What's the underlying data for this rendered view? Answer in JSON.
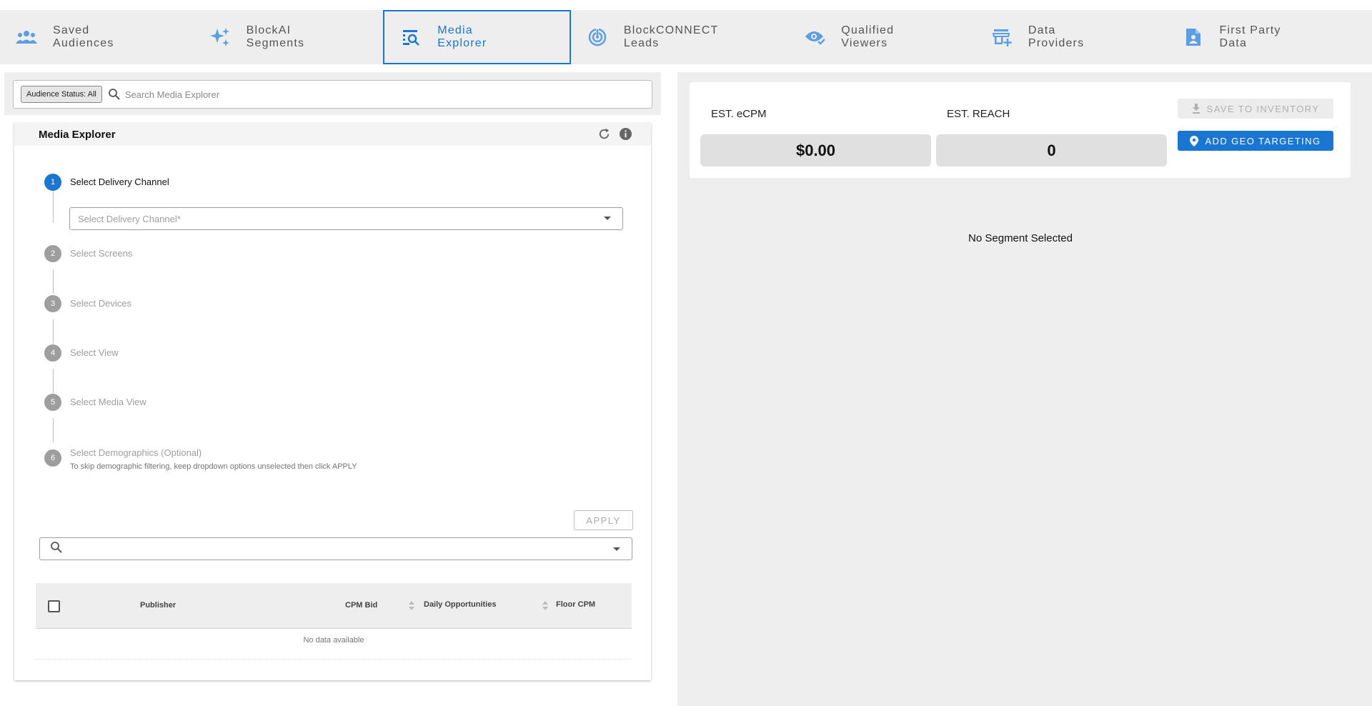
{
  "nav": {
    "tabs": [
      {
        "label": "Saved\nAudiences",
        "icon": "people-icon"
      },
      {
        "label": "BlockAI\nSegments",
        "icon": "sparkle-icon"
      },
      {
        "label": "Media\nExplorer",
        "icon": "media-search-icon",
        "active": true
      },
      {
        "label": "BlockCONNECT\nLeads",
        "icon": "radar-icon"
      },
      {
        "label": "Qualified\nViewers",
        "icon": "eye-check-icon"
      },
      {
        "label": "Data\nProviders",
        "icon": "store-add-icon"
      },
      {
        "label": "First Party\nData",
        "icon": "file-person-icon"
      }
    ],
    "accent_color": "#1976d2",
    "icon_color": "#5a9fe6"
  },
  "search": {
    "status_chip": "Audience Status: All",
    "placeholder": "Search Media Explorer"
  },
  "explorer": {
    "title": "Media Explorer",
    "steps": [
      {
        "num": "1",
        "label": "Select Delivery Channel",
        "active": true
      },
      {
        "num": "2",
        "label": "Select Screens"
      },
      {
        "num": "3",
        "label": "Select Devices"
      },
      {
        "num": "4",
        "label": "Select View"
      },
      {
        "num": "5",
        "label": "Select Media View"
      },
      {
        "num": "6",
        "label": "Select Demographics (Optional)",
        "sub": "To skip demographic filtering, keep dropdown options unselected then click APPLY"
      }
    ],
    "channel_placeholder": "Select Delivery Channel*",
    "apply_label": "APPLY"
  },
  "table": {
    "columns": [
      "Publisher",
      "CPM Bid",
      "Daily Opportunities",
      "Floor CPM"
    ],
    "empty_text": "No data available"
  },
  "estimates": {
    "ecpm_label": "EST. eCPM",
    "ecpm_value": "$0.00",
    "reach_label": "EST. REACH",
    "reach_value": "0",
    "save_label": "SAVE TO INVENTORY",
    "geo_label": "ADD GEO TARGETING"
  },
  "status": {
    "no_segment": "No Segment Selected"
  }
}
